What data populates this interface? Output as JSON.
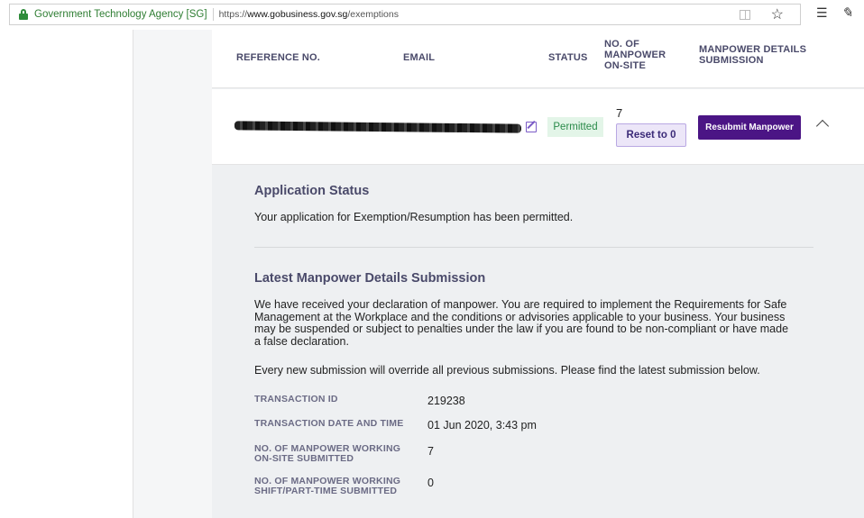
{
  "browser": {
    "site_name": "Government Technology Agency [SG]",
    "url_prefix": "https://",
    "url_domain": "www.gobusiness.gov.sg",
    "url_path": "/exemptions"
  },
  "table": {
    "headers": {
      "reference": "REFERENCE NO.",
      "email": "EMAIL",
      "status": "STATUS",
      "manpower_line1": "NO. OF",
      "manpower_line2": "MANPOWER",
      "manpower_line3": "ON-SITE",
      "details_line1": "MANPOWER DETAILS",
      "details_line2": "SUBMISSION"
    },
    "row": {
      "status": "Permitted",
      "manpower_count": "7",
      "reset_label": "Reset to 0",
      "resubmit_label": "Resubmit Manpower"
    }
  },
  "application_status": {
    "title": "Application Status",
    "text": "Your application for Exemption/Resumption has been permitted."
  },
  "latest_submission": {
    "title": "Latest Manpower Details Submission",
    "declaration_lines": [
      "We have received your declaration of manpower. You are required to implement the Requirements for Safe",
      "Management at the Workplace and the conditions or advisories applicable to your business. Your business",
      "may be suspended or subject to penalties under the law if you are found to be non-compliant or have made",
      "a false declaration."
    ],
    "override_note": "Every new submission will override all previous submissions. Please find the latest submission below.",
    "details": [
      {
        "label_lines": [
          "TRANSACTION ID"
        ],
        "value": "219238"
      },
      {
        "label_lines": [
          "TRANSACTION DATE AND TIME"
        ],
        "value": "01 Jun 2020, 3:43 pm"
      },
      {
        "label_lines": [
          "NO. OF MANPOWER WORKING",
          "ON-SITE SUBMITTED"
        ],
        "value": "7"
      },
      {
        "label_lines": [
          "NO. OF MANPOWER WORKING",
          "SHIFT/PART-TIME SUBMITTED"
        ],
        "value": "0"
      }
    ]
  },
  "colors": {
    "primary": "#4b1585",
    "status_green": "#2a8a4a",
    "status_bg": "#e3f5e8"
  },
  "icons": [
    "lock-icon",
    "reader-mode-icon",
    "star-icon",
    "favorites-icon",
    "pen-icon",
    "edit-icon",
    "chevron-up-icon"
  ]
}
